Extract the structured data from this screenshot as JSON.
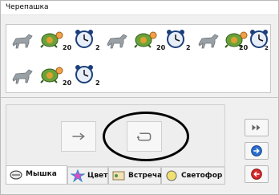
{
  "window": {
    "title": "Черепашка"
  },
  "program": {
    "rows": [
      [
        {
          "icon": "horse-icon"
        },
        {
          "icon": "turtle-icon",
          "count": "20"
        },
        {
          "icon": "alarm-clock-icon",
          "count": "2"
        },
        {
          "icon": "horse-icon"
        },
        {
          "icon": "turtle-icon",
          "count": "20"
        },
        {
          "icon": "alarm-clock-icon",
          "count": "2"
        },
        {
          "icon": "horse-icon"
        },
        {
          "icon": "turtle-icon",
          "count": "20"
        },
        {
          "icon": "alarm-clock-icon",
          "count": "2"
        }
      ],
      [
        {
          "icon": "horse-icon"
        },
        {
          "icon": "turtle-icon",
          "count": "20"
        },
        {
          "icon": "alarm-clock-icon",
          "count": "2"
        }
      ]
    ]
  },
  "palette": {
    "buttons": [
      {
        "icon": "arrow-right-icon"
      },
      {
        "icon": "repeat-loop-icon"
      }
    ]
  },
  "tabs": [
    {
      "label": "Мышка",
      "icon": "mouse-icon"
    },
    {
      "label": "Цвет",
      "icon": "color-star-icon"
    },
    {
      "label": "Встреча",
      "icon": "meeting-icon"
    },
    {
      "label": "Светофор",
      "icon": "traffic-light-icon"
    }
  ],
  "side_buttons": [
    {
      "icon": "fast-forward-icon"
    },
    {
      "icon": "blue-arrow-icon"
    },
    {
      "icon": "red-arrow-icon"
    }
  ]
}
